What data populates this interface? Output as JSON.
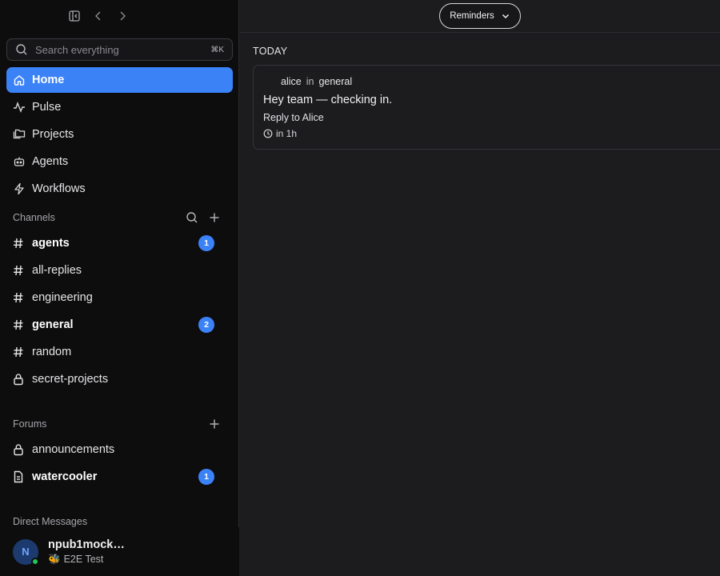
{
  "header": {
    "reminders_label": "Reminders"
  },
  "search": {
    "placeholder": "Search everything",
    "shortcut": "⌘K"
  },
  "nav": [
    {
      "label": "Home",
      "icon": "home-icon",
      "active": true
    },
    {
      "label": "Pulse",
      "icon": "pulse-icon"
    },
    {
      "label": "Projects",
      "icon": "projects-icon"
    },
    {
      "label": "Agents",
      "icon": "bot-icon"
    },
    {
      "label": "Workflows",
      "icon": "lightning-icon"
    }
  ],
  "channels": {
    "heading": "Channels",
    "items": [
      {
        "name": "agents",
        "icon": "hash-icon",
        "unread": 1
      },
      {
        "name": "all-replies",
        "icon": "hash-icon"
      },
      {
        "name": "engineering",
        "icon": "hash-icon"
      },
      {
        "name": "general",
        "icon": "hash-icon",
        "unread": 2
      },
      {
        "name": "random",
        "icon": "hash-icon"
      },
      {
        "name": "secret-projects",
        "icon": "lock-icon"
      }
    ]
  },
  "forums": {
    "heading": "Forums",
    "items": [
      {
        "name": "announcements",
        "icon": "lock-icon"
      },
      {
        "name": "watercooler",
        "icon": "document-icon",
        "unread": 1
      }
    ]
  },
  "direct_messages": {
    "heading": "Direct Messages"
  },
  "user": {
    "initial": "N",
    "name": "npub1mock…",
    "status_emoji": "🐝",
    "status": "E2E Test"
  },
  "reminders": {
    "day_label": "TODAY",
    "items": [
      {
        "author": "alice",
        "in_word": "in",
        "channel": "general",
        "message": "Hey team — checking in.",
        "reply_label": "Reply to Alice",
        "due": "in 1h"
      }
    ]
  },
  "colors": {
    "accent": "#3b82f6",
    "sidebar_bg": "#0d0d0e",
    "main_bg": "#1c1c1f",
    "online": "#22c55e"
  }
}
